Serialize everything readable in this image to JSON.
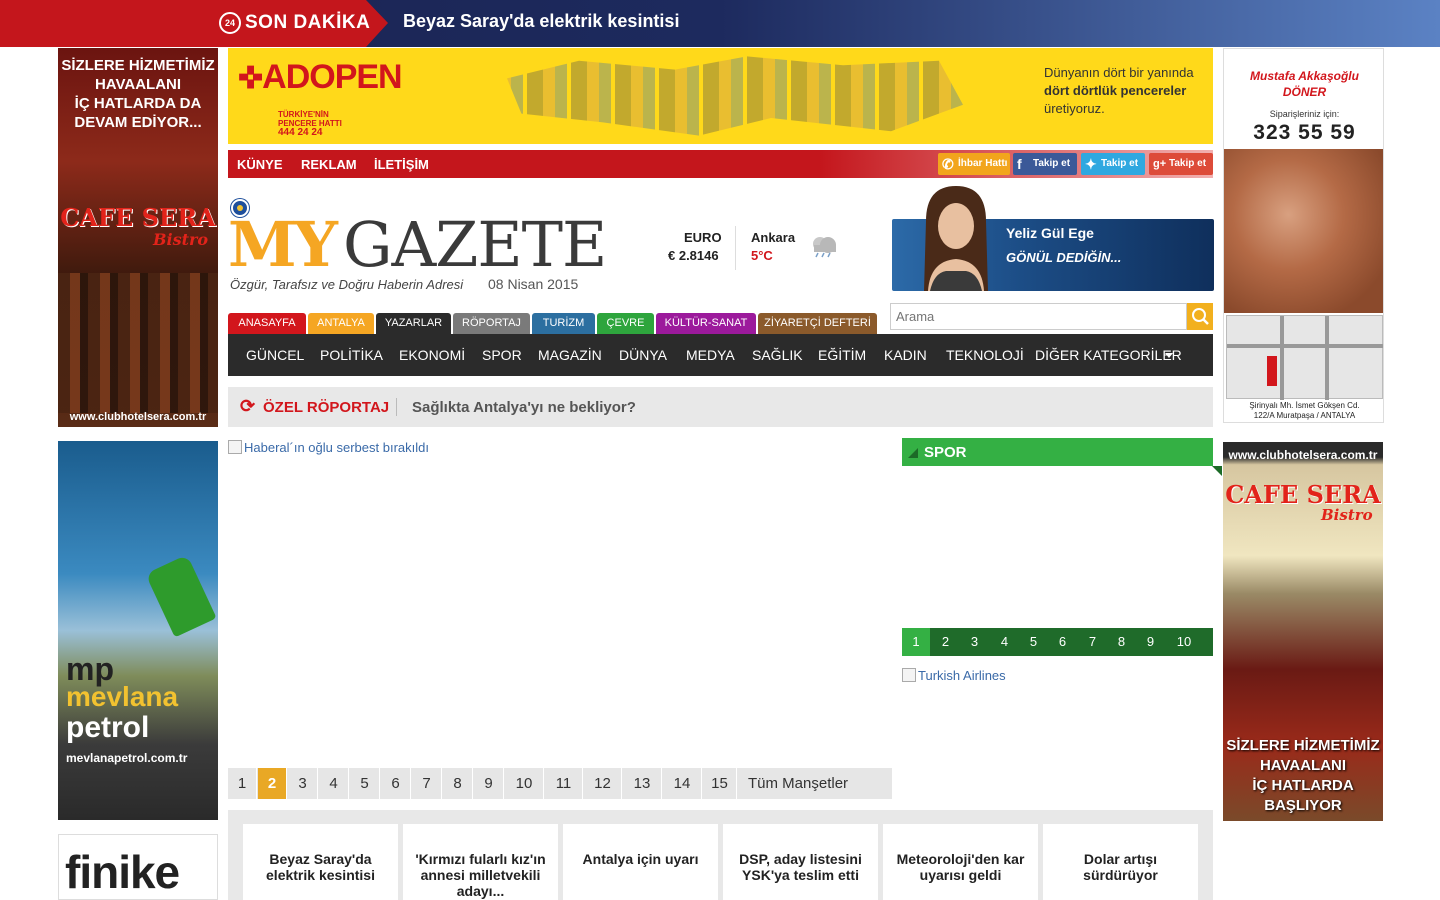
{
  "breaking": {
    "badge": "24",
    "label": "SON DAKİKA",
    "headline": "Beyaz Saray'da elektrik kesintisi"
  },
  "ads": {
    "left_top": {
      "line1": "SİZLERE HİZMETİMİZ",
      "line2": "HAVAALANI",
      "line3": "İÇ HATLARDA DA",
      "line4": "DEVAM EDİYOR...",
      "brand": "CAFE SERA",
      "brand_sub": "Bistro",
      "url": "www.clubhotelsera.com.tr"
    },
    "left_mid": {
      "logo": "mp",
      "name1": "mevlana",
      "name2": "petrol",
      "url": "mevlanapetrol.com.tr"
    },
    "left_bottom": {
      "text": "finike"
    },
    "right_top": {
      "brand": "Mustafa Akkaşoğlu",
      "brand2": "DÖNER",
      "sub": "Siparişleriniz için:",
      "phone": "323 55 59",
      "address1": "Şirinyalı Mh. İsmet Gökşen Cd.",
      "address2": "122/A Muratpaşa / ANTALYA"
    },
    "right_mid": {
      "url": "www.clubhotelsera.com.tr",
      "brand": "CAFE SERA",
      "brand_sub": "Bistro",
      "line1": "SİZLERE HİZMETİMİZ",
      "line2": "HAVAALANI",
      "line3": "İÇ HATLARDA",
      "line4": "BAŞLIYOR"
    },
    "top_banner": {
      "logo": "ADOPEN",
      "hotline1": "TÜRKİYE'NİN",
      "hotline2": "PENCERE HATTI",
      "hotline3": "444 24 24",
      "copy1": "Dünyanın dört bir yanında",
      "copy2": "dört dörtlük pencereler",
      "copy3": "üretiyoruz."
    }
  },
  "top_nav": [
    "KÜNYE",
    "REKLAM",
    "İLETİŞİM"
  ],
  "social": {
    "ihbar": "İhbar Hattı",
    "facebook": "Takip et",
    "twitter": "Takip et",
    "google": "Takip et"
  },
  "logo": {
    "my": "MY",
    "gazete": "GAZETE",
    "slogan": "Özgür, Tarafsız ve Doğru Haberin Adresi",
    "date": "08 Nisan 2015"
  },
  "currency": {
    "label": "EURO",
    "value": "€ 2.8146"
  },
  "weather": {
    "city": "Ankara",
    "temp": "5°C"
  },
  "columnist": {
    "name": "Yeliz Gül Ege",
    "title": "GÖNÜL DEDİĞİN..."
  },
  "search": {
    "placeholder": "Arama"
  },
  "color_tabs": [
    {
      "label": "ANASAYFA",
      "color": "#d2161c"
    },
    {
      "label": "ANTALYA",
      "color": "#f5a623"
    },
    {
      "label": "YAZARLAR",
      "color": "#2b2b2b"
    },
    {
      "label": "RÖPORTAJ",
      "color": "#7a7a7a"
    },
    {
      "label": "TURİZM",
      "color": "#2c6fa0"
    },
    {
      "label": "ÇEVRE",
      "color": "#2ea53d"
    },
    {
      "label": "KÜLTÜR-SANAT",
      "color": "#9c1a9c"
    },
    {
      "label": "ZİYARETÇİ DEFTERİ",
      "color": "#8b5a2b"
    }
  ],
  "categories": [
    "GÜNCEL",
    "POLİTİKA",
    "EKONOMİ",
    "SPOR",
    "MAGAZİN",
    "DÜNYA",
    "MEDYA",
    "SAĞLIK",
    "EĞİTİM",
    "KADIN",
    "TEKNOLOJİ",
    "DİĞER KATEGORİLER"
  ],
  "special": {
    "label": "ÖZEL RÖPORTAJ",
    "text": "Sağlıkta Antalya'yı ne bekliyor?"
  },
  "headline": {
    "alt": "Haberal´ın oğlu serbest bırakıldı"
  },
  "headline_pager": {
    "pages": [
      "1",
      "2",
      "3",
      "4",
      "5",
      "6",
      "7",
      "8",
      "9",
      "10",
      "11",
      "12",
      "13",
      "14",
      "15"
    ],
    "active": "2",
    "all": "Tüm Manşetler"
  },
  "spor": {
    "label": "SPOR",
    "pages": [
      "1",
      "2",
      "3",
      "4",
      "5",
      "6",
      "7",
      "8",
      "9",
      "10"
    ],
    "active": "1"
  },
  "sidebar_ad": {
    "alt": "Turkish Airlines"
  },
  "cards": [
    "Beyaz Saray'da elektrik kesintisi",
    "'Kırmızı fularlı kız'ın annesi milletvekili adayı...",
    "Antalya için uyarı",
    "DSP, aday listesini YSK'ya teslim etti",
    "Meteoroloji'den kar uyarısı geldi",
    "Dolar artışı sürdürüyor"
  ]
}
